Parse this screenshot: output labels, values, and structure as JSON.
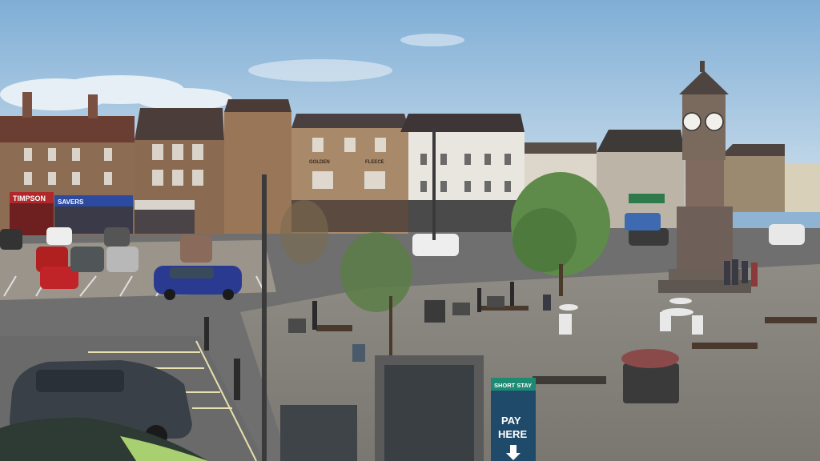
{
  "scene": {
    "description_visible_text": {
      "shop_sign_1": "TIMPSON",
      "shop_sign_2": "SAVERS",
      "hotel_name_1": "GOLDEN",
      "hotel_name_2": "FLEECE",
      "parking_sign_top": "SHORT STAY",
      "parking_sign_main_1": "PAY",
      "parking_sign_main_2": "HERE"
    },
    "colors": {
      "sky_top": "#7faed6",
      "sky_bottom": "#cfe0ec",
      "brick": "#8a6a52",
      "roof": "#4a3a35",
      "stone_paving": "#8d8a84",
      "tarmac": "#6c6c6c",
      "tree_green": "#5e8a4a",
      "parking_sign_teal": "#1f8a73",
      "parking_sign_blue": "#1f4a6a",
      "clock_tower_stone": "#7a6a5e",
      "shop_red": "#b0282a",
      "shop_blue": "#2b4aa0",
      "white_building": "#e9e6e0"
    }
  }
}
